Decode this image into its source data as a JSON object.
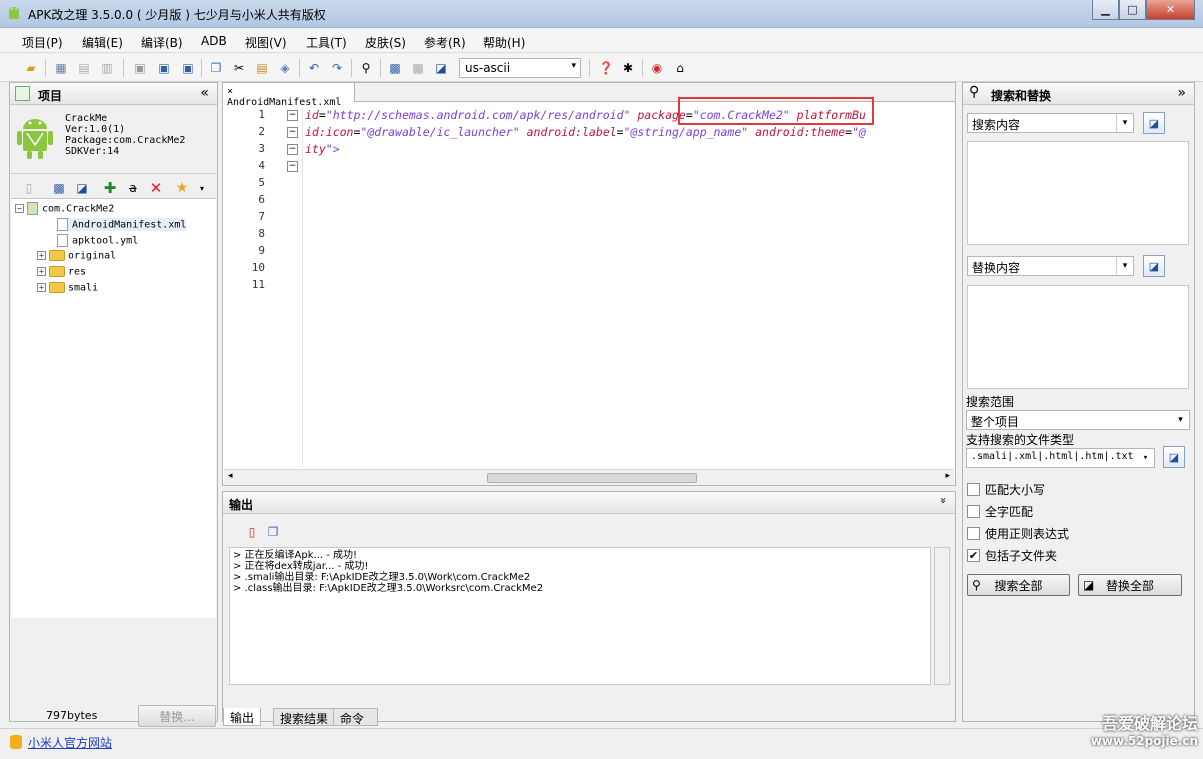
{
  "window": {
    "title": "APK改之理 3.5.0.0 ( 少月版 ) 七少月与小米人共有版权",
    "minimize": "▁",
    "maximize": "□",
    "close": "✕"
  },
  "menu": [
    "项目(P)",
    "编辑(E)",
    "编译(B)",
    "ADB",
    "视图(V)",
    "工具(T)",
    "皮肤(S)",
    "参考(R)",
    "帮助(H)"
  ],
  "toolbar": {
    "encoding": "us-ascii"
  },
  "project": {
    "title": "项目",
    "collapse": "«",
    "app_info": [
      "CrackMe",
      "Ver:1.0(1)",
      "Package:com.CrackMe2",
      "SDKVer:14"
    ],
    "tree": {
      "root": "com.CrackMe2",
      "files": [
        "AndroidManifest.xml",
        "apktool.yml"
      ],
      "folders": [
        "original",
        "res",
        "smali"
      ]
    },
    "size": "797bytes",
    "replace_btn": "替换..."
  },
  "editor": {
    "tab": "AndroidManifest.xml",
    "tab_close": "×",
    "line_numbers": [
      "1",
      "2",
      "3",
      "4",
      "5",
      "6",
      "7",
      "8",
      "9",
      "10",
      "11"
    ],
    "line1": {
      "a1": "id",
      "e1": "=",
      "s1": "\"http://schemas.android.com/apk/res/android\"",
      "a2": "package",
      "e2": "=",
      "s2": "\"com.CrackMe2\"",
      "a3": "platformBu"
    },
    "line2": {
      "a1": "id:icon",
      "e1": "=",
      "s1": "\"@drawable/ic_launcher\"",
      "a2": "android:label",
      "e2": "=",
      "s2": "\"@string/app_name\"",
      "a3": "android:theme",
      "e3": "=",
      "s3": "\"@"
    },
    "line3": {
      "a1": "ity",
      "p": "\">"
    }
  },
  "output": {
    "title": "输出",
    "collapse": "»",
    "lines": [
      "> 正在反编译Apk...  - 成功!",
      "> 正在将dex转成jar...  - 成功!",
      "> .smali输出目录: F:\\ApkIDE改之理3.5.0\\Work\\com.CrackMe2",
      "> .class输出目录: F:\\ApkIDE改之理3.5.0\\Worksrc\\com.CrackMe2"
    ],
    "tabs": [
      "输出",
      "搜索结果",
      "命令"
    ]
  },
  "search": {
    "title": "搜索和替换",
    "collapse": "»",
    "search_label": "搜索内容",
    "replace_label": "替换内容",
    "scope_label": "搜索范围",
    "scope_value": "整个项目",
    "types_label": "支持搜索的文件类型",
    "types_value": ".smali|.xml|.html|.htm|.txt",
    "options": [
      {
        "label": "匹配大小写",
        "checked": false
      },
      {
        "label": "全字匹配",
        "checked": false
      },
      {
        "label": "使用正则表达式",
        "checked": false
      },
      {
        "label": "包括子文件夹",
        "checked": true
      }
    ],
    "search_all": "搜索全部",
    "replace_all": "替换全部"
  },
  "status": {
    "link": "小米人官方网站"
  },
  "watermark": {
    "line1": "吾爱破解论坛",
    "line2": "www.52pojie.cn"
  }
}
